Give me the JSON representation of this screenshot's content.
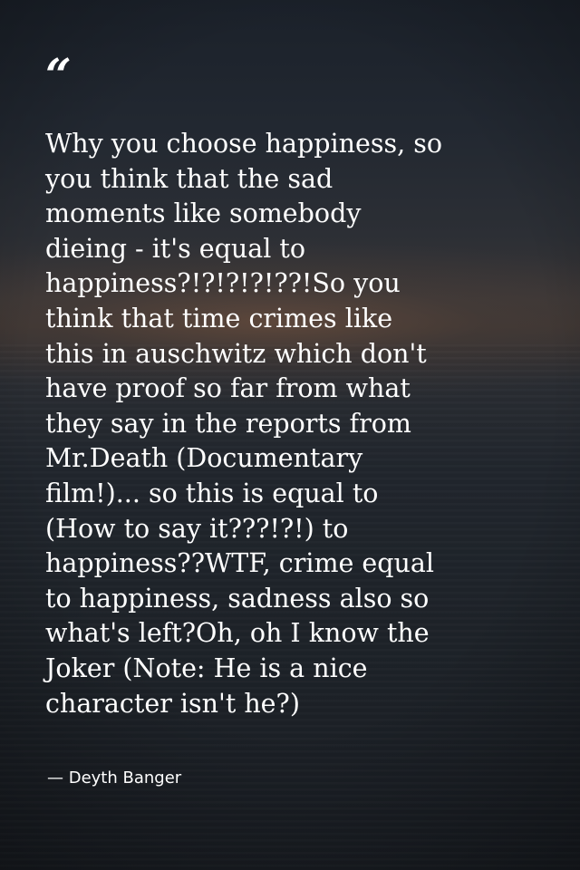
{
  "quote": {
    "mark": "“",
    "lines": [
      "Why you choose happiness, so",
      "you think that the sad",
      "moments like somebody",
      "dieing - it's equal to",
      "happiness?!?!?!?!??!So you",
      "think that time crimes like",
      "this in auschwitz which don't",
      "have proof so far from what",
      "they say in the reports from",
      "Mr.Death (Documentary",
      "film!)... so this is equal to",
      "(How to say it???!?!) to",
      "happiness??WTF, crime equal",
      "to happiness, sadness also so",
      "what's left?Oh, oh I know the",
      "Joker (Note: He is a nice",
      "character isn't he?)"
    ],
    "author": "— Deyth Banger"
  },
  "colors": {
    "text": "#ffffff",
    "sky_top": "#1b212a",
    "horizon_glow": "#785541",
    "sea": "#1e2329"
  }
}
